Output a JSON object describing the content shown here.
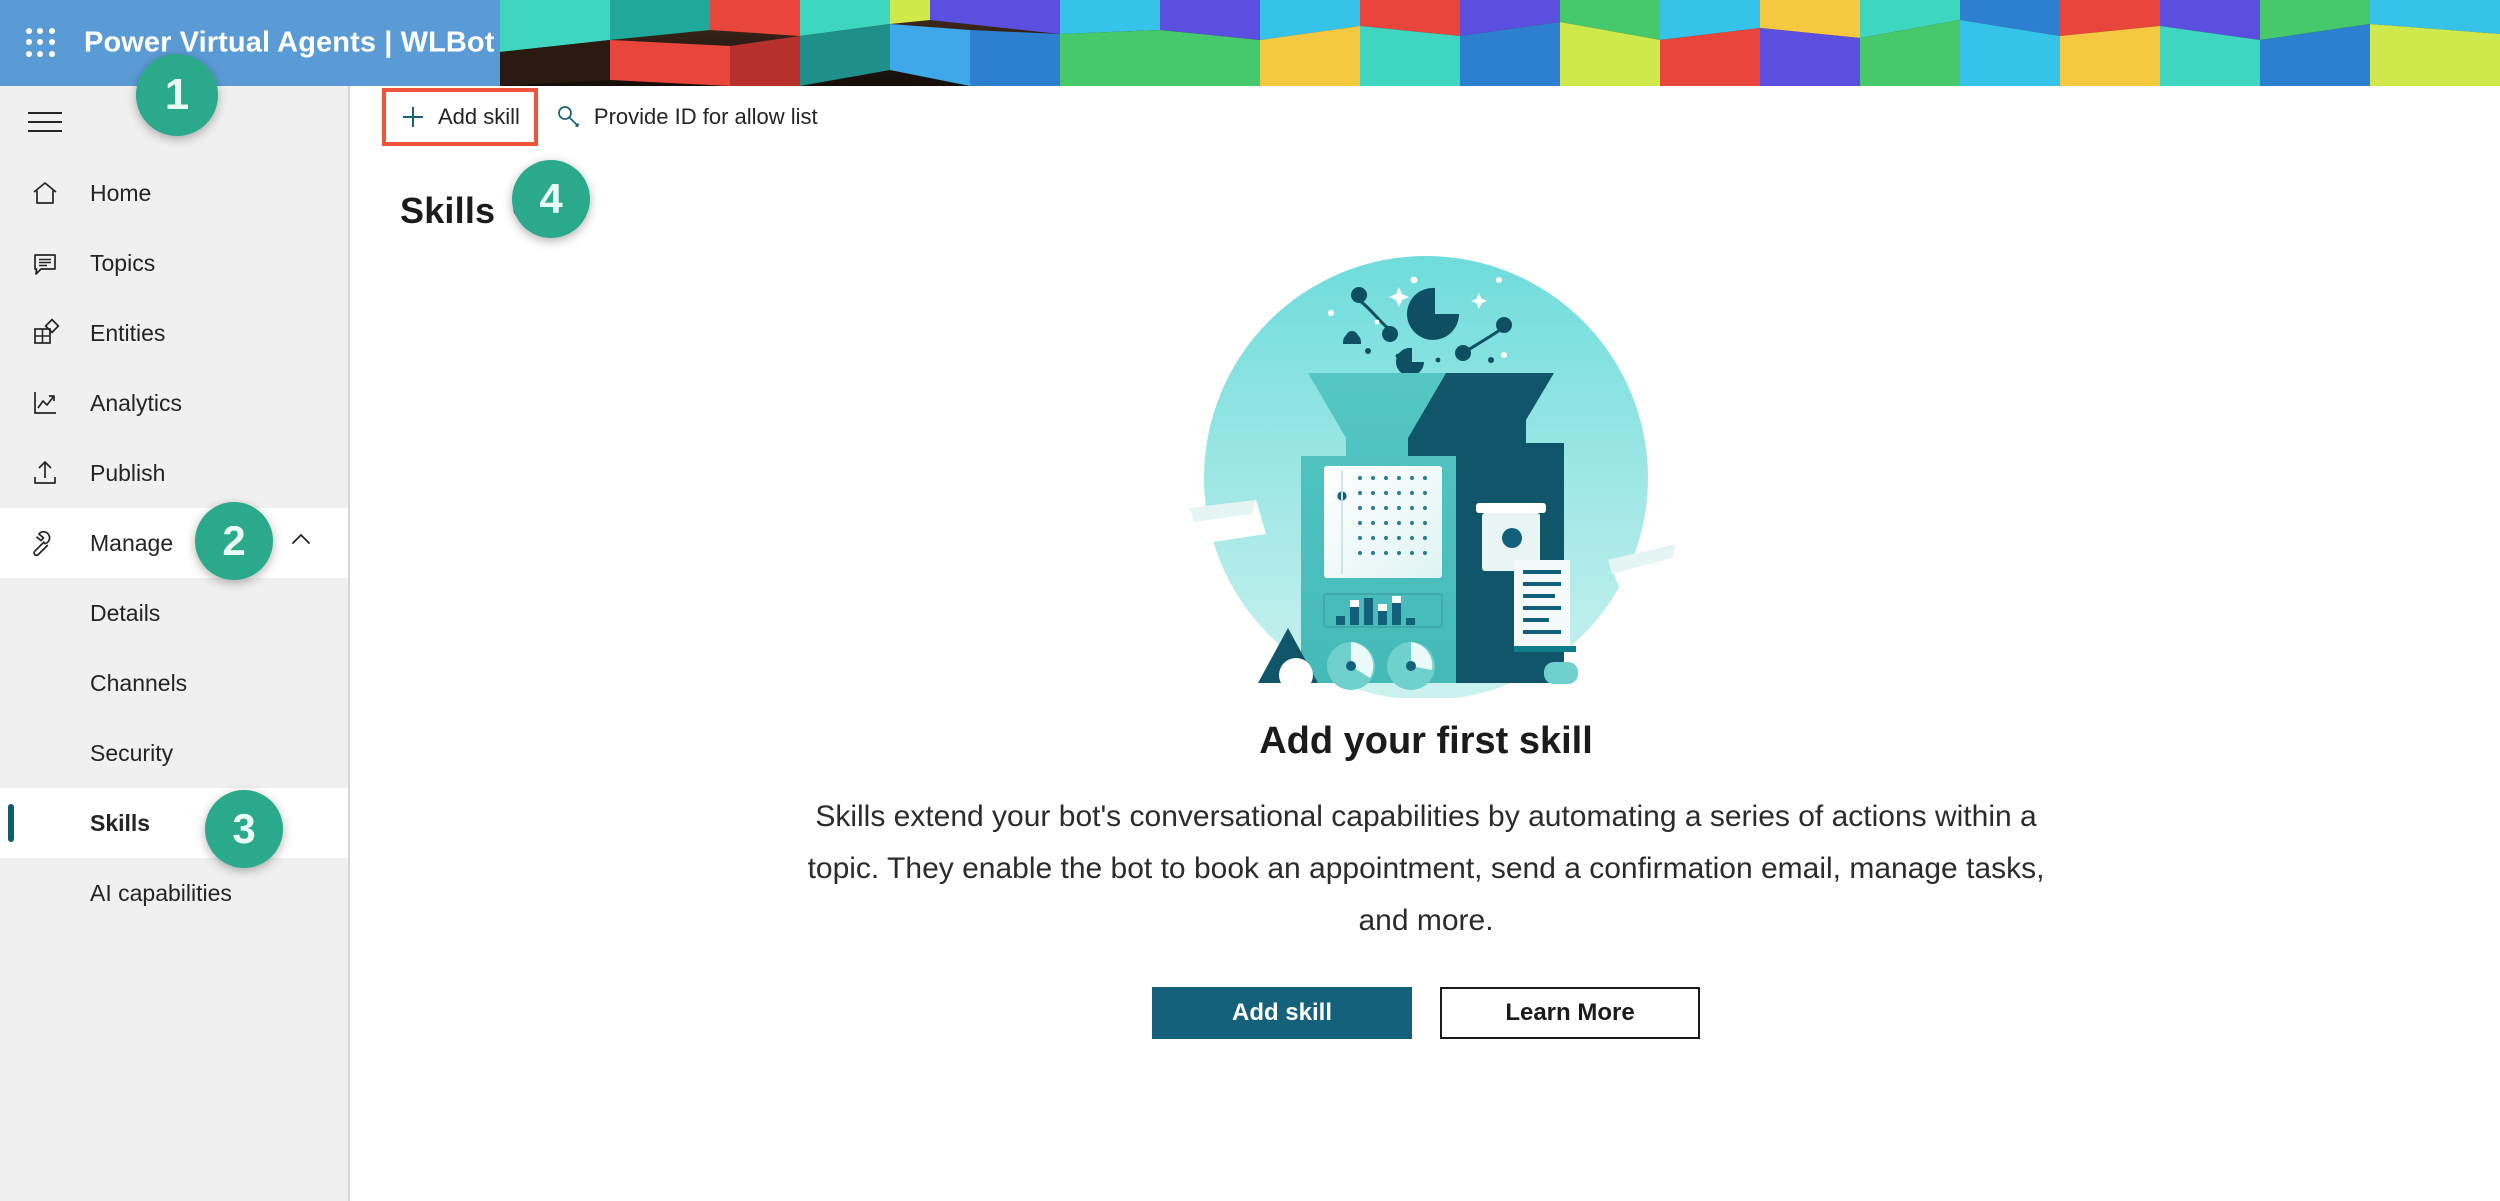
{
  "header": {
    "waffle_icon": "app-launcher-icon",
    "title": "Power Virtual Agents | WLBot",
    "brand_blue": "#5b9bd5"
  },
  "command_bar": {
    "add_skill": {
      "label": "Add skill",
      "icon": "plus-icon",
      "highlight_color": "#f0553c"
    },
    "provide_id": {
      "label": "Provide ID for allow list",
      "icon": "key-icon"
    }
  },
  "sidebar": {
    "hamburger_icon": "hamburger-menu-icon",
    "items": [
      {
        "label": "Home",
        "icon": "home-icon"
      },
      {
        "label": "Topics",
        "icon": "chat-bubble-icon"
      },
      {
        "label": "Entities",
        "icon": "entities-icon"
      },
      {
        "label": "Analytics",
        "icon": "chart-line-icon"
      },
      {
        "label": "Publish",
        "icon": "upload-icon"
      },
      {
        "label": "Manage",
        "icon": "wrench-icon",
        "expanded": true,
        "chevron": "chevron-up-icon"
      }
    ],
    "sub_items": [
      {
        "label": "Details"
      },
      {
        "label": "Channels"
      },
      {
        "label": "Security"
      },
      {
        "label": "Skills",
        "selected": true
      },
      {
        "label": "AI capabilities"
      }
    ],
    "selected_accent": "#0d5e72"
  },
  "page": {
    "title": "Skills",
    "info_icon": "info-circle-icon"
  },
  "empty_state": {
    "illustration": "skills-machine-illustration",
    "heading": "Add your first skill",
    "body": "Skills extend your bot's conversational capabilities by automating a series of actions within a topic. They enable the bot to book an appointment, send a confirmation email, manage tasks, and more.",
    "primary_button": "Add skill",
    "secondary_button": "Learn More",
    "primary_color": "#15607a"
  },
  "badges": {
    "one": "1",
    "two": "2",
    "three": "3",
    "four": "4",
    "color": "#2aa98b"
  }
}
